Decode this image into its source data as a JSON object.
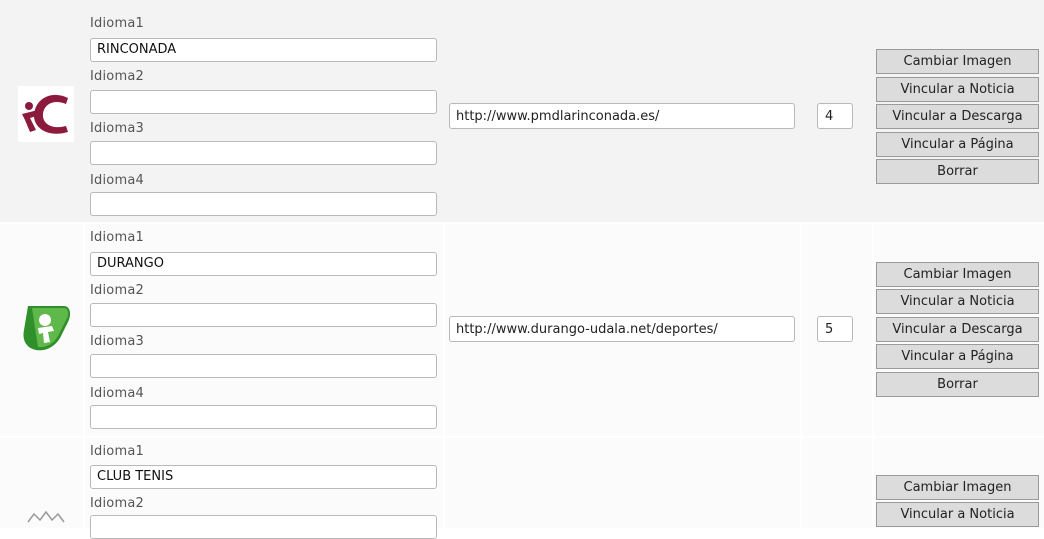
{
  "rows": [
    {
      "logo": "rinconada-logo",
      "names": [
        {
          "label": "Idioma1",
          "value": "RINCONADA"
        },
        {
          "label": "Idioma2",
          "value": ""
        },
        {
          "label": "Idioma3",
          "value": ""
        },
        {
          "label": "Idioma4",
          "value": ""
        }
      ],
      "url": "http://www.pmdlarinconada.es/",
      "order": "4"
    },
    {
      "logo": "durango-logo",
      "names": [
        {
          "label": "Idioma1",
          "value": "DURANGO"
        },
        {
          "label": "Idioma2",
          "value": ""
        },
        {
          "label": "Idioma3",
          "value": ""
        },
        {
          "label": "Idioma4",
          "value": ""
        }
      ],
      "url": "http://www.durango-udala.net/deportes/",
      "order": "5"
    },
    {
      "logo": "club-tenis-logo",
      "names": [
        {
          "label": "Idioma1",
          "value": "CLUB TENIS"
        },
        {
          "label": "Idioma2",
          "value": ""
        }
      ]
    }
  ],
  "actions": {
    "change_image": "Cambiar Imagen",
    "link_news": "Vincular a Noticia",
    "link_download": "Vincular a Descarga",
    "link_page": "Vincular a Página",
    "delete": "Borrar"
  },
  "colors": {
    "rinconada_logo": "#8b1a3c",
    "durango_logo": "#2f8f2a"
  }
}
